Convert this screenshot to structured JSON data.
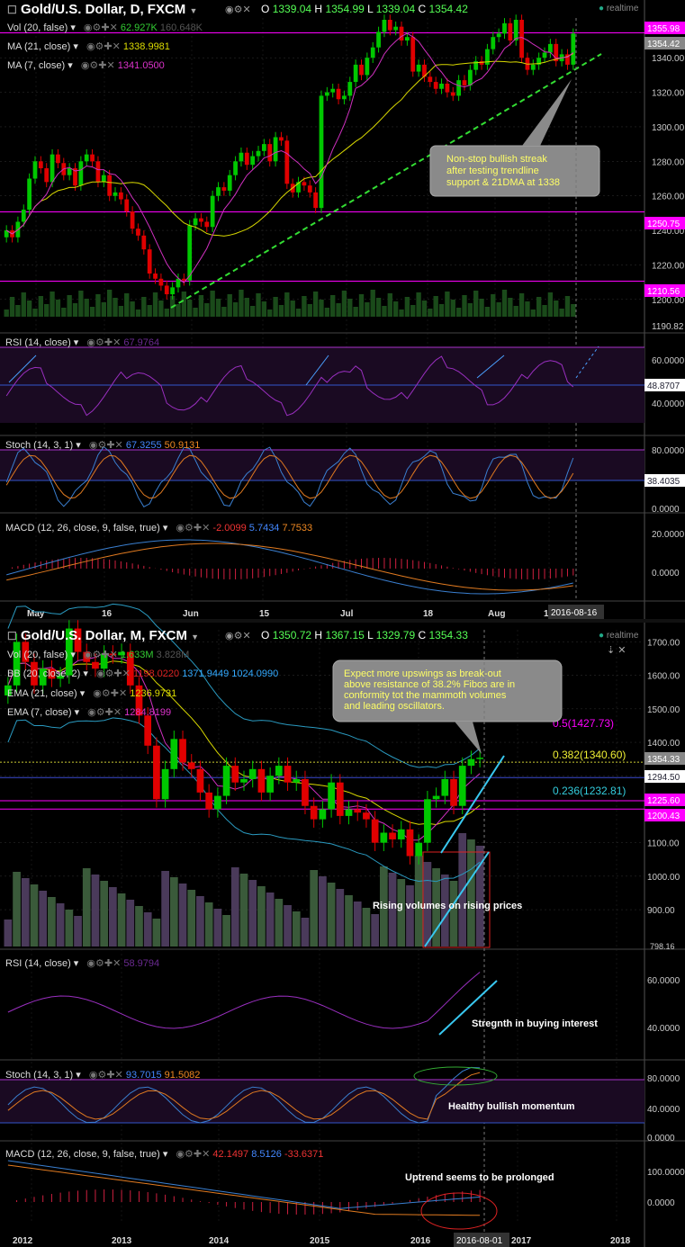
{
  "colors": {
    "up": "#00c800",
    "down": "#e00000",
    "bg": "#000000",
    "grid": "#333333",
    "ma21": "#d8d800",
    "ma7": "#d030c0",
    "rsi": "#9a2fc0",
    "blue": "#3a7fd0",
    "orange": "#e07a20",
    "macd_hist": "#d02040",
    "trend": "#33dd33",
    "note_bg": "#8a8a8a",
    "magenta": "#ff00ff"
  },
  "top_chart": {
    "title": "Gold/U.S. Dollar, D, FXCM",
    "ohlc": {
      "o": "1339.04",
      "h": "1354.99",
      "l": "1339.04",
      "c": "1354.42"
    },
    "realtime": "realtime",
    "indicators": [
      {
        "label": "Vol (20, false)",
        "v1": "62.927K",
        "v2": "160.648K"
      },
      {
        "label": "MA (21, close)",
        "v1": "1338.9981"
      },
      {
        "label": "MA (7, close)",
        "v1": "1341.0500"
      }
    ],
    "price_axis": [
      "1340.00",
      "1320.00",
      "1300.00",
      "1280.00",
      "1260.00",
      "1240.00",
      "1220.00",
      "1200.00"
    ],
    "price_tags": [
      "1355.98",
      "1354.42",
      "1250.75",
      "1210.56",
      "1190.82"
    ],
    "note": "Non-stop bullish streak after testing trendline support & 21DMA at 1338",
    "date_tag": "2016-08-16",
    "x_labels": [
      "May",
      "16",
      "Jun",
      "15",
      "Jul",
      "18",
      "Aug",
      "15"
    ],
    "rsi": {
      "label": "RSI (14, close)",
      "value": "67.9764",
      "axis": [
        "60.0000",
        "40.0000"
      ],
      "tag": "48.8707"
    },
    "stoch": {
      "label": "Stoch (14, 3, 1)",
      "v1": "67.3255",
      "v2": "50.9131",
      "axis": [
        "80.0000",
        "0.0000"
      ],
      "tag": "38.4035"
    },
    "macd": {
      "label": "MACD (12, 26, close, 9, false, true)",
      "v1": "-2.0099",
      "v2": "5.7434",
      "v3": "7.7533",
      "axis": [
        "20.0000",
        "0.0000"
      ]
    }
  },
  "bottom_chart": {
    "title": "Gold/U.S. Dollar, M, FXCM",
    "ohlc": {
      "o": "1350.72",
      "h": "1367.15",
      "l": "1329.79",
      "c": "1354.33"
    },
    "realtime": "realtime",
    "indicators": [
      {
        "label": "Vol (20, false)",
        "v1": "1.633M",
        "v2": "3.828M"
      },
      {
        "label": "BB (20, close, 2)",
        "v1": "1198.0220",
        "v2": "1371.9449",
        "v3": "1024.0990"
      },
      {
        "label": "EMA (21, close)",
        "v1": "1236.9731"
      },
      {
        "label": "EMA (7, close)",
        "v1": "1284.8199"
      }
    ],
    "price_axis": [
      "1700.00",
      "1600.00",
      "1500.00",
      "1400.00",
      "1300.00",
      "1100.00",
      "1000.00",
      "900.00"
    ],
    "price_tags": [
      "1354.33",
      "1294.50",
      "1225.60",
      "1200.43",
      "798.16"
    ],
    "fibs": [
      {
        "label": "0.5(1427.73)"
      },
      {
        "label": "0.382(1340.60)"
      },
      {
        "label": "0.236(1232.81)"
      }
    ],
    "note": "Expect more upswings as break-out above resistance of 38.2% Fibos are in conformity tot the mammoth volumes and leading oscillators.",
    "vol_note": "Rising volumes on rising prices",
    "date_tag": "2016-08-01",
    "x_labels": [
      "2012",
      "2013",
      "2014",
      "2015",
      "2016",
      "2017",
      "2018"
    ],
    "rsi": {
      "label": "RSI (14, close)",
      "value": "58.9794",
      "axis": [
        "60.0000",
        "40.0000"
      ],
      "note": "Stregnth in buying interest"
    },
    "stoch": {
      "label": "Stoch (14, 3, 1)",
      "v1": "93.7015",
      "v2": "91.5082",
      "axis": [
        "80.0000",
        "40.0000",
        "0.0000"
      ],
      "note": "Healthy bullish momentum"
    },
    "macd": {
      "label": "MACD (12, 26, close, 9, false, true)",
      "v1": "42.1497",
      "v2": "8.5126",
      "v3": "-33.6371",
      "axis": [
        "100.0000",
        "0.0000"
      ],
      "note": "Uptrend seems to be prolonged"
    }
  },
  "chart_data": [
    {
      "type": "candlestick",
      "title": "Gold/U.S. Dollar, D, FXCM",
      "ylim": [
        1190,
        1365
      ],
      "closes": [
        1240,
        1236,
        1245,
        1252,
        1270,
        1280,
        1276,
        1268,
        1284,
        1279,
        1272,
        1276,
        1266,
        1280,
        1284,
        1280,
        1268,
        1272,
        1260,
        1262,
        1258,
        1251,
        1241,
        1237,
        1229,
        1215,
        1212,
        1208,
        1203,
        1207,
        1212,
        1211,
        1243,
        1247,
        1245,
        1242,
        1260,
        1265,
        1263,
        1272,
        1280,
        1285,
        1278,
        1283,
        1286,
        1290,
        1280,
        1294,
        1292,
        1267,
        1262,
        1268,
        1266,
        1262,
        1253,
        1318,
        1320,
        1322,
        1316,
        1318,
        1326,
        1336,
        1330,
        1340,
        1346,
        1355,
        1362,
        1356,
        1358,
        1350,
        1352,
        1332,
        1336,
        1329,
        1326,
        1322,
        1325,
        1320,
        1318,
        1327,
        1324,
        1333,
        1338,
        1336,
        1345,
        1352,
        1354,
        1360,
        1350,
        1362,
        1340,
        1333,
        1336,
        1340,
        1343,
        1348,
        1338,
        1342,
        1336,
        1354
      ],
      "ma21_level": 1338.9981,
      "ma7_level": 1341.05,
      "trendline": "rising dotted support"
    },
    {
      "type": "candlestick",
      "title": "Gold/U.S. Dollar, M, FXCM",
      "ylim": [
        790,
        1720
      ],
      "closes": [
        1570,
        1700,
        1640,
        1570,
        1620,
        1590,
        1600,
        1740,
        1670,
        1640,
        1620,
        1665,
        1660,
        1670,
        1570,
        1480,
        1390,
        1230,
        1320,
        1410,
        1340,
        1320,
        1250,
        1200,
        1240,
        1330,
        1280,
        1290,
        1320,
        1250,
        1300,
        1330,
        1280,
        1290,
        1210,
        1170,
        1200,
        1280,
        1180,
        1200,
        1190,
        1170,
        1100,
        1130,
        1110,
        1140,
        1060,
        1100,
        1230,
        1240,
        1290,
        1210,
        1330,
        1350,
        1354
      ],
      "fib_levels": {
        "0.236": 1232.81,
        "0.382": 1340.6,
        "0.5": 1427.73
      }
    }
  ]
}
